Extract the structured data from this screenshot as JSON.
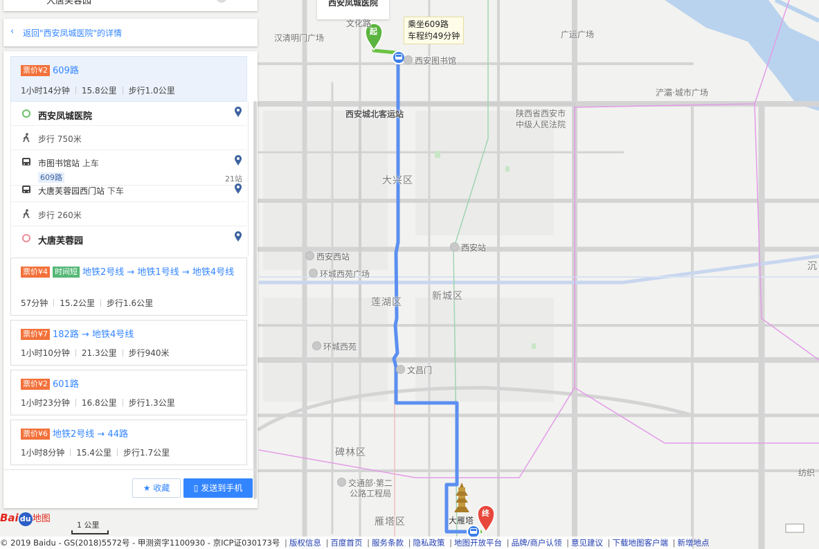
{
  "top_stub": {
    "label": "大唐芙蓉园"
  },
  "top_dest_label": "西安凤城医院",
  "back_link": {
    "label": "返回\"西安凤城医院\"的详情"
  },
  "routes": [
    {
      "price": "票价¥2",
      "fast": "",
      "title": "609路",
      "time": "1小时14分钟",
      "distance": "15.8公里",
      "walk": "步行1.0公里"
    },
    {
      "price": "票价¥4",
      "fast": "时间短",
      "title": "地铁2号线 → 地铁1号线 → 地铁4号线",
      "time": "57分钟",
      "distance": "15.2公里",
      "walk": "步行1.6公里"
    },
    {
      "price": "票价¥7",
      "fast": "",
      "title": "182路 → 地铁4号线",
      "time": "1小时10分钟",
      "distance": "21.3公里",
      "walk": "步行940米"
    },
    {
      "price": "票价¥2",
      "fast": "",
      "title": "601路",
      "time": "1小时23分钟",
      "distance": "16.8公里",
      "walk": "步行1.3公里"
    },
    {
      "price": "票价¥6",
      "fast": "",
      "title": "地铁2号线 → 44路",
      "time": "1小时8分钟",
      "distance": "15.4公里",
      "walk": "步行1.7公里"
    }
  ],
  "steps": {
    "start": "西安凤城医院",
    "walk1": "步行 750米",
    "board_stop": "市图书馆站",
    "board_action": "上车",
    "bus_line": "609路",
    "stop_count": "21站",
    "alight_stop": "大唐芙蓉园西门站",
    "alight_action": "下车",
    "walk2": "步行 260米",
    "end": "大唐芙蓉园"
  },
  "buttons": {
    "favorite": "收藏",
    "send_to_phone": "发送到手机"
  },
  "callout": {
    "line1": "乘坐609路",
    "line2": "车程约49分钟"
  },
  "markers": {
    "start": "起",
    "end": "终"
  },
  "map_labels": {
    "hanqing": "汉清明门广场",
    "wenhua": "文化路",
    "guangyun": "广运广场",
    "library": "西安图书馆",
    "bus_station": "西安城北客运站",
    "chanba": "浐灞·城市广场",
    "hospital_l1": "陕西省西安市",
    "hospital_l2": "中级人民法院",
    "daxing": "大兴区",
    "xian_west": "西安西站",
    "xian_station": "西安站",
    "huancheng_west": "环城西苑广场",
    "lianhu": "莲湖区",
    "xincheng": "新城区",
    "huanchengxiyuan": "环城西苑",
    "wenchang": "文昌门",
    "beilin": "碑林区",
    "jiaotong1": "交通部·第二",
    "jiaotong2": "公路工程局",
    "yanta": "雁塔区",
    "dayanta": "大雁塔",
    "fangzhi": "纺织",
    "pao": "沉"
  },
  "logo": {
    "text1": "Bai",
    "text2": "du",
    "text3": "地图"
  },
  "scale": {
    "label": "1 公里"
  },
  "copyright": {
    "text": "© 2019 Baidu - GS(2018)5572号 - 甲测资字1100930 - 京ICP证030173号",
    "links": [
      "版权信息",
      "百度首页",
      "服务条款",
      "隐私政策",
      "地图开放平台",
      "品牌/商户认领",
      "意见建议",
      "下载地图客户端",
      "新增地点"
    ]
  },
  "colors": {
    "accent": "#3385ff",
    "route_line": "#5b8ff0",
    "price_tag": "#f3713a",
    "fast_tag": "#55b877",
    "road_gray": "#d9d9d9",
    "river": "#a8c8e8",
    "pink_road": "#e39be7"
  }
}
